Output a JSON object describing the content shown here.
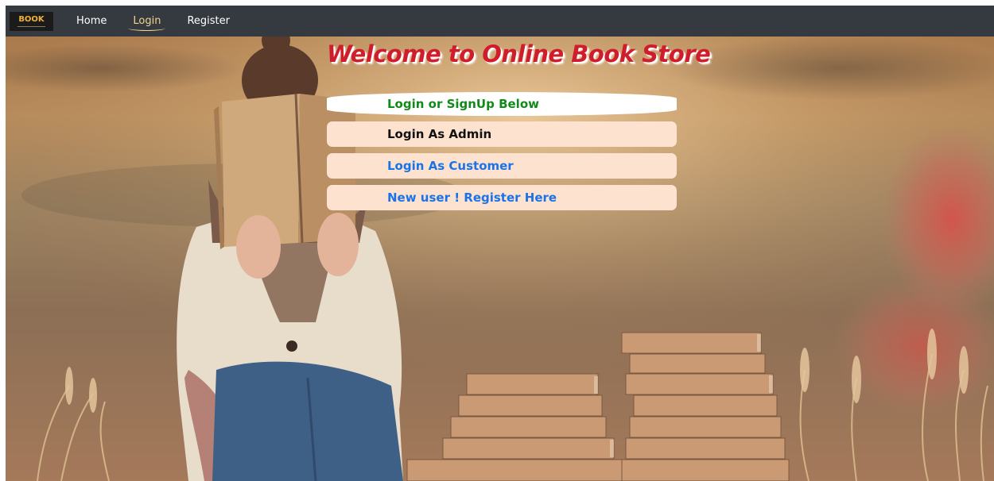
{
  "navbar": {
    "logo_text": "BOOK",
    "links": [
      "Home",
      "Login",
      "Register"
    ],
    "active_link": "Login"
  },
  "hero": {
    "title": "Welcome to Online Book Store",
    "panel": {
      "header": "Login or SignUp Below",
      "items": [
        "Login As Admin",
        "Login As Customer",
        "New user ! Register Here"
      ]
    }
  },
  "colors": {
    "navbar_bg": "#343a40",
    "title": "#cf1d2b",
    "panel_header_text": "#118a1a",
    "admin_text": "#111111",
    "link_blue": "#1a73e8",
    "panel_item_bg": "#fde3cf"
  }
}
